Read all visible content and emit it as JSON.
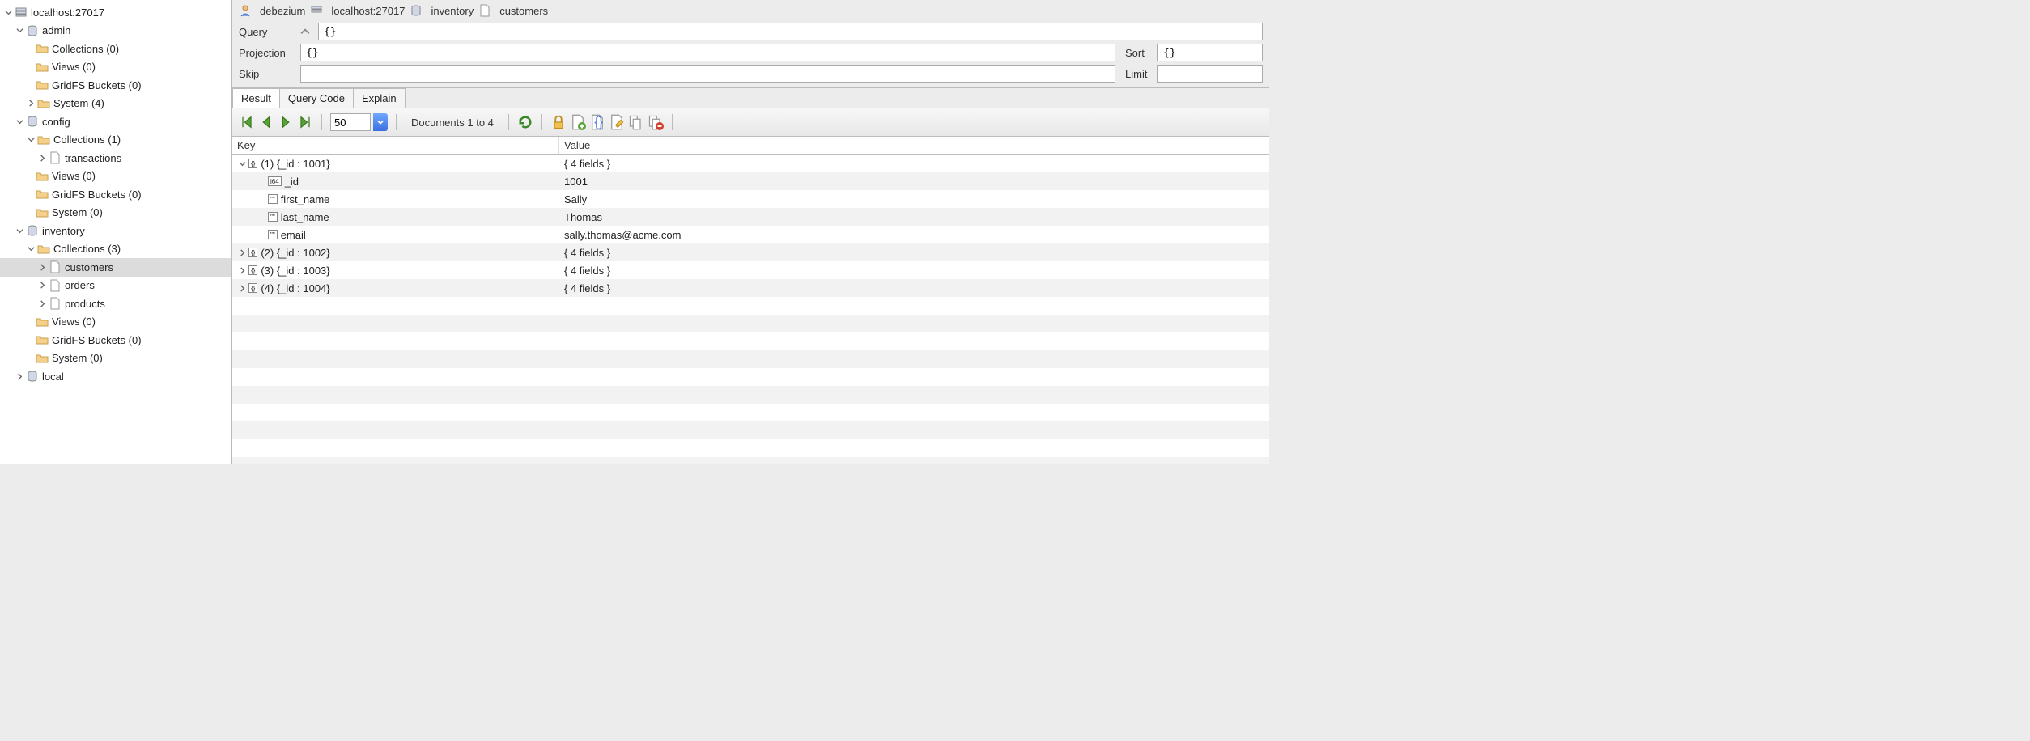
{
  "sidebar": {
    "root": "localhost:27017",
    "databases": [
      {
        "name": "admin",
        "nodes": [
          {
            "label": "Collections (0)",
            "type": "folder"
          },
          {
            "label": "Views (0)",
            "type": "folder"
          },
          {
            "label": "GridFS Buckets (0)",
            "type": "folder"
          },
          {
            "label": "System (4)",
            "type": "folder",
            "expandable": true
          }
        ]
      },
      {
        "name": "config",
        "nodes": [
          {
            "label": "Collections (1)",
            "type": "folder",
            "expanded": true,
            "children": [
              {
                "label": "transactions",
                "type": "collection",
                "expandable": true
              }
            ]
          },
          {
            "label": "Views (0)",
            "type": "folder"
          },
          {
            "label": "GridFS Buckets (0)",
            "type": "folder"
          },
          {
            "label": "System (0)",
            "type": "folder"
          }
        ]
      },
      {
        "name": "inventory",
        "nodes": [
          {
            "label": "Collections (3)",
            "type": "folder",
            "expanded": true,
            "children": [
              {
                "label": "customers",
                "type": "collection",
                "selected": true,
                "expandable": true
              },
              {
                "label": "orders",
                "type": "collection",
                "expandable": true
              },
              {
                "label": "products",
                "type": "collection",
                "expandable": true
              }
            ]
          },
          {
            "label": "Views (0)",
            "type": "folder"
          },
          {
            "label": "GridFS Buckets (0)",
            "type": "folder"
          },
          {
            "label": "System (0)",
            "type": "folder"
          }
        ]
      },
      {
        "name": "local",
        "collapsed": true
      }
    ]
  },
  "breadcrumb": {
    "user": "debezium",
    "host": "localhost:27017",
    "database": "inventory",
    "collection": "customers"
  },
  "query": {
    "query_label": "Query",
    "query_value": "{}",
    "projection_label": "Projection",
    "projection_value": "{}",
    "sort_label": "Sort",
    "sort_value": "{}",
    "skip_label": "Skip",
    "skip_value": "",
    "limit_label": "Limit",
    "limit_value": ""
  },
  "tabs": {
    "result": "Result",
    "query_code": "Query Code",
    "explain": "Explain"
  },
  "toolbar": {
    "page_size": "50",
    "doc_range": "Documents 1 to 4"
  },
  "results": {
    "header_key": "Key",
    "header_value": "Value",
    "rows": [
      {
        "indent": 0,
        "arrow": "down",
        "badge": "{}",
        "key": "(1) {_id : 1001}",
        "value": "{ 4 fields }"
      },
      {
        "indent": 1,
        "badge": "i64",
        "key": "_id",
        "value": "1001"
      },
      {
        "indent": 1,
        "badge": "\"\"",
        "key": "first_name",
        "value": "Sally"
      },
      {
        "indent": 1,
        "badge": "\"\"",
        "key": "last_name",
        "value": "Thomas"
      },
      {
        "indent": 1,
        "badge": "\"\"",
        "key": "email",
        "value": "sally.thomas@acme.com"
      },
      {
        "indent": 0,
        "arrow": "right",
        "badge": "{}",
        "key": "(2) {_id : 1002}",
        "value": "{ 4 fields }"
      },
      {
        "indent": 0,
        "arrow": "right",
        "badge": "{}",
        "key": "(3) {_id : 1003}",
        "value": "{ 4 fields }"
      },
      {
        "indent": 0,
        "arrow": "right",
        "badge": "{}",
        "key": "(4) {_id : 1004}",
        "value": "{ 4 fields }"
      }
    ]
  }
}
